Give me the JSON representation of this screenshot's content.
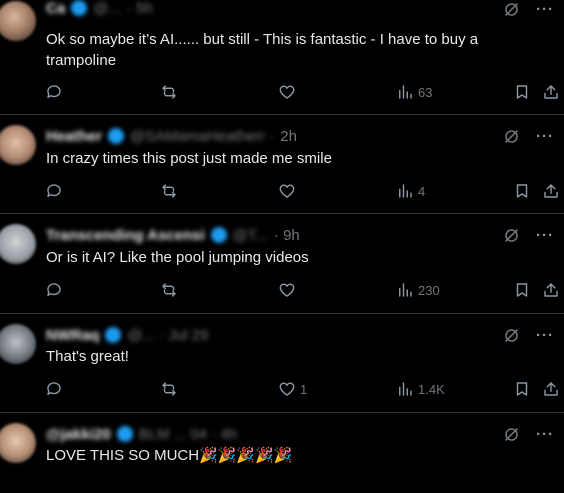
{
  "replies": [
    {
      "name": "Ca",
      "handle": "@...",
      "time": "· 5h",
      "text": "Ok so maybe it’s AI...... but still - This is fantastic - I have to buy a\ntrampoline",
      "views": "63",
      "likes": ""
    },
    {
      "name": "Heather",
      "handle": "@SAMamaHeatherr ·",
      "time": "2h",
      "text": "In crazy times this post just made me smile",
      "views": "4",
      "likes": ""
    },
    {
      "name": "Transcending Ascensi",
      "handle": "@T...",
      "time": "· 9h",
      "text": "Or is it AI? Like the pool jumping videos",
      "views": "230",
      "likes": ""
    },
    {
      "name": "NWRaq",
      "handle": "@... · Jul 29",
      "time": "",
      "text": "That's great!",
      "views": "1.4K",
      "likes": "1"
    },
    {
      "name": "@jakki20",
      "handle": "BLM ... 04 · 4h",
      "time": "",
      "text": "LOVE THIS SO MUCH🎉🎉🎉🎉🎉",
      "views": "",
      "likes": ""
    }
  ]
}
